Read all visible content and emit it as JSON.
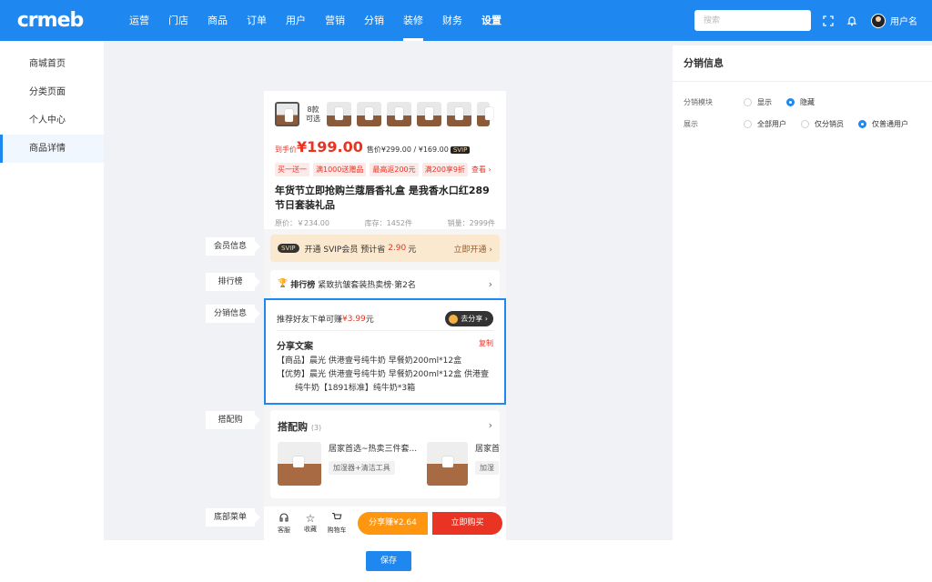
{
  "app": {
    "logo": "crmeb"
  },
  "nav": {
    "items": [
      "运营",
      "门店",
      "商品",
      "订单",
      "用户",
      "营销",
      "分销",
      "装修",
      "财务",
      "设置"
    ],
    "active_index": 7,
    "search_placeholder": "搜索",
    "username": "用户名"
  },
  "sidebar": {
    "items": [
      "商城首页",
      "分类页面",
      "个人中心",
      "商品详情"
    ],
    "active_index": 3
  },
  "labels": {
    "member": "会员信息",
    "rank": "排行榜",
    "dist": "分销信息",
    "combo": "搭配购",
    "bottom": "底部菜单"
  },
  "product": {
    "thumb_count_text": "8款可选",
    "price_label": "到手价",
    "price": "¥199.00",
    "old_price": "售价¥299.00 / ¥169.00",
    "svip_tag": "SVIP",
    "coupons": [
      "买一送一",
      "满1000送赠品",
      "最高返200元",
      "满200享9折"
    ],
    "coupon_more": "查看 ›",
    "title": "年货节立即抢购兰蔻唇香礼盒 是我香水口红289节日套装礼品",
    "orig_price": "原价：￥234.00",
    "stock": "库存：1452件",
    "sales": "销量：2999件"
  },
  "member": {
    "badge": "SVIP",
    "text_prefix": "开通 SVIP会员 预计省",
    "save": "2.90",
    "unit": "元",
    "action": "立即开通 ›"
  },
  "rank": {
    "icon": "🏆",
    "label": "排行榜",
    "text": "紧致抗皱套装热卖榜·第2名",
    "arrow": "›"
  },
  "dist": {
    "recommend_prefix": "推荐好友下单可赚",
    "amount": "¥3.99",
    "unit": "元",
    "share_btn": "去分享 ›",
    "copy_title": "分享文案",
    "copy_btn": "复制",
    "line1": "【商品】晨光  供港壹号纯牛奶 早餐奶200ml*12盒",
    "line2": "【优势】晨光  供港壹号纯牛奶 早餐奶200ml*12盒 供港壹",
    "line3": "纯牛奶【1891标准】纯牛奶*3箱"
  },
  "combo": {
    "title": "搭配购",
    "count": "(3)",
    "item1_name": "居家首选~热卖三件套...",
    "item1_sub": "加湿器+清洁工具",
    "item2_name": "居家首",
    "item2_sub": "加湿"
  },
  "bottom_menu": {
    "service": "客服",
    "favorite": "收藏",
    "cart": "购物车",
    "share": "分享赚¥2.64",
    "buy": "立即购买"
  },
  "panel": {
    "title": "分销信息",
    "row1_label": "分销模块",
    "row1_opt1": "显示",
    "row1_opt2": "隐藏",
    "row2_label": "展示",
    "row2_opt1": "全部用户",
    "row2_opt2": "仅分销员",
    "row2_opt3": "仅普通用户"
  },
  "footer": {
    "save": "保存"
  },
  "colors": {
    "primary": "#1e88f0",
    "price_red": "#e93323",
    "share_orange": "#fe960f"
  }
}
